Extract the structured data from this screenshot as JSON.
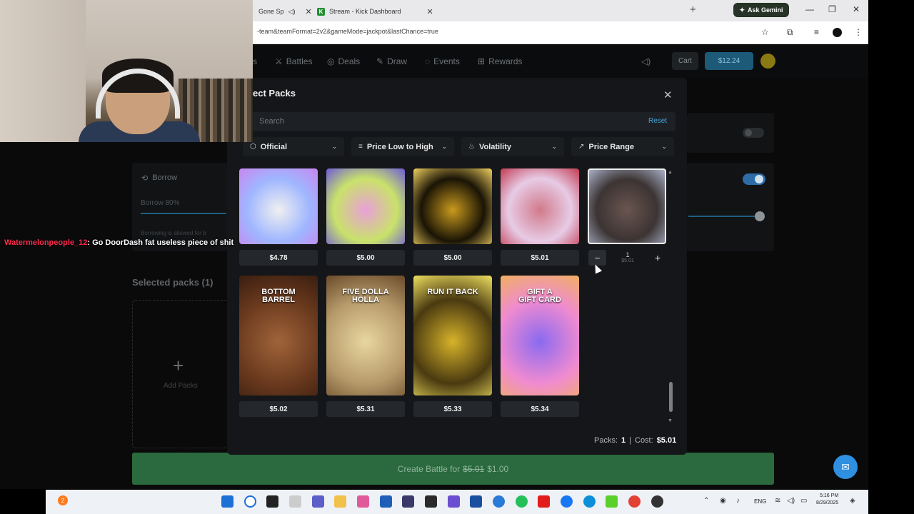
{
  "browser": {
    "tabs": [
      {
        "label": "Gone Sp"
      },
      {
        "label": "Stream - Kick Dashboard"
      }
    ],
    "new_tab_label": "+",
    "gemini_label": "Ask Gemini",
    "url": "-team&teamFormat=2v2&gameMode=jackpot&lastChance=true"
  },
  "nav": {
    "partial_label": "s",
    "items": [
      {
        "label": "Battles",
        "icon": "swords-icon"
      },
      {
        "label": "Deals",
        "icon": "tag-icon"
      },
      {
        "label": "Draw",
        "icon": "pencil-icon"
      },
      {
        "label": "Events",
        "icon": "calendar-icon"
      },
      {
        "label": "Rewards",
        "icon": "gift-icon"
      }
    ],
    "cart_label": "Cart",
    "balance": "$12.24"
  },
  "background": {
    "borrow_title": "Borrow",
    "borrow_sub": "Borrow 80%",
    "borrow_note": "Borrowing is allowed for b",
    "selected_title": "Selected packs (1)",
    "add_plus": "+",
    "add_label": "Add Packs"
  },
  "chat": {
    "user": "Watermelonpeople_12",
    "message": ": Go DoorDash fat useless piece of shit"
  },
  "modal": {
    "title": "ect Packs",
    "close": "✕",
    "search_placeholder": "Search",
    "reset": "Reset",
    "filters": [
      {
        "label": "Official",
        "icon": "cube-icon"
      },
      {
        "label": "Price Low to High",
        "icon": "sort-icon"
      },
      {
        "label": "Volatility",
        "icon": "flame-icon"
      },
      {
        "label": "Price Range",
        "icon": "trend-icon"
      }
    ],
    "packs_row1": [
      {
        "price": "$4.78",
        "colors": [
          "#9fb6ff",
          "#f0f0f0",
          "#c986f0"
        ]
      },
      {
        "price": "$5.00",
        "colors": [
          "#c9e26a",
          "#e9a0d8",
          "#6d5ad8"
        ]
      },
      {
        "price": "$5.00",
        "colors": [
          "#1a1405",
          "#c99a1e",
          "#f2d060"
        ]
      },
      {
        "price": "$5.01",
        "colors": [
          "#e7cbe5",
          "#d17a8a",
          "#c23a52"
        ]
      },
      {
        "price": "",
        "colors": [
          "#3c3433",
          "#6a5550",
          "#a9b0c8"
        ]
      }
    ],
    "packs_row2": [
      {
        "title": "BOTTOM\nBARREL",
        "price": "$5.02",
        "colors": [
          "#6b3a1e",
          "#a0643a",
          "#3a1e10"
        ]
      },
      {
        "title": "FIVE DOLLA\nHOLLA",
        "price": "$5.31",
        "colors": [
          "#b69a6a",
          "#e8d6a0",
          "#6a4a2a"
        ]
      },
      {
        "title": "RUN IT BACK",
        "price": "$5.33",
        "colors": [
          "#4a3a10",
          "#d7b32a",
          "#f0e060"
        ]
      },
      {
        "title": "GIFT A\nGIFT CARD",
        "price": "$5.34",
        "colors": [
          "#f08bd0",
          "#8a6af0",
          "#f0b060"
        ]
      }
    ],
    "quantity": {
      "minus": "−",
      "value": "1",
      "sub": "$5.01",
      "plus": "+"
    },
    "footer": {
      "packs_label": "Packs:",
      "packs_value": "1",
      "sep": "|",
      "cost_label": "Cost:",
      "cost_value": "$5.01"
    }
  },
  "create_battle": {
    "prefix": "Create Battle for",
    "old_price": "$5.01",
    "new_price": "$1.00"
  },
  "taskbar": {
    "badge": "2",
    "lang": "ENG",
    "time": "5:16 PM",
    "date": "8/29/2025"
  }
}
